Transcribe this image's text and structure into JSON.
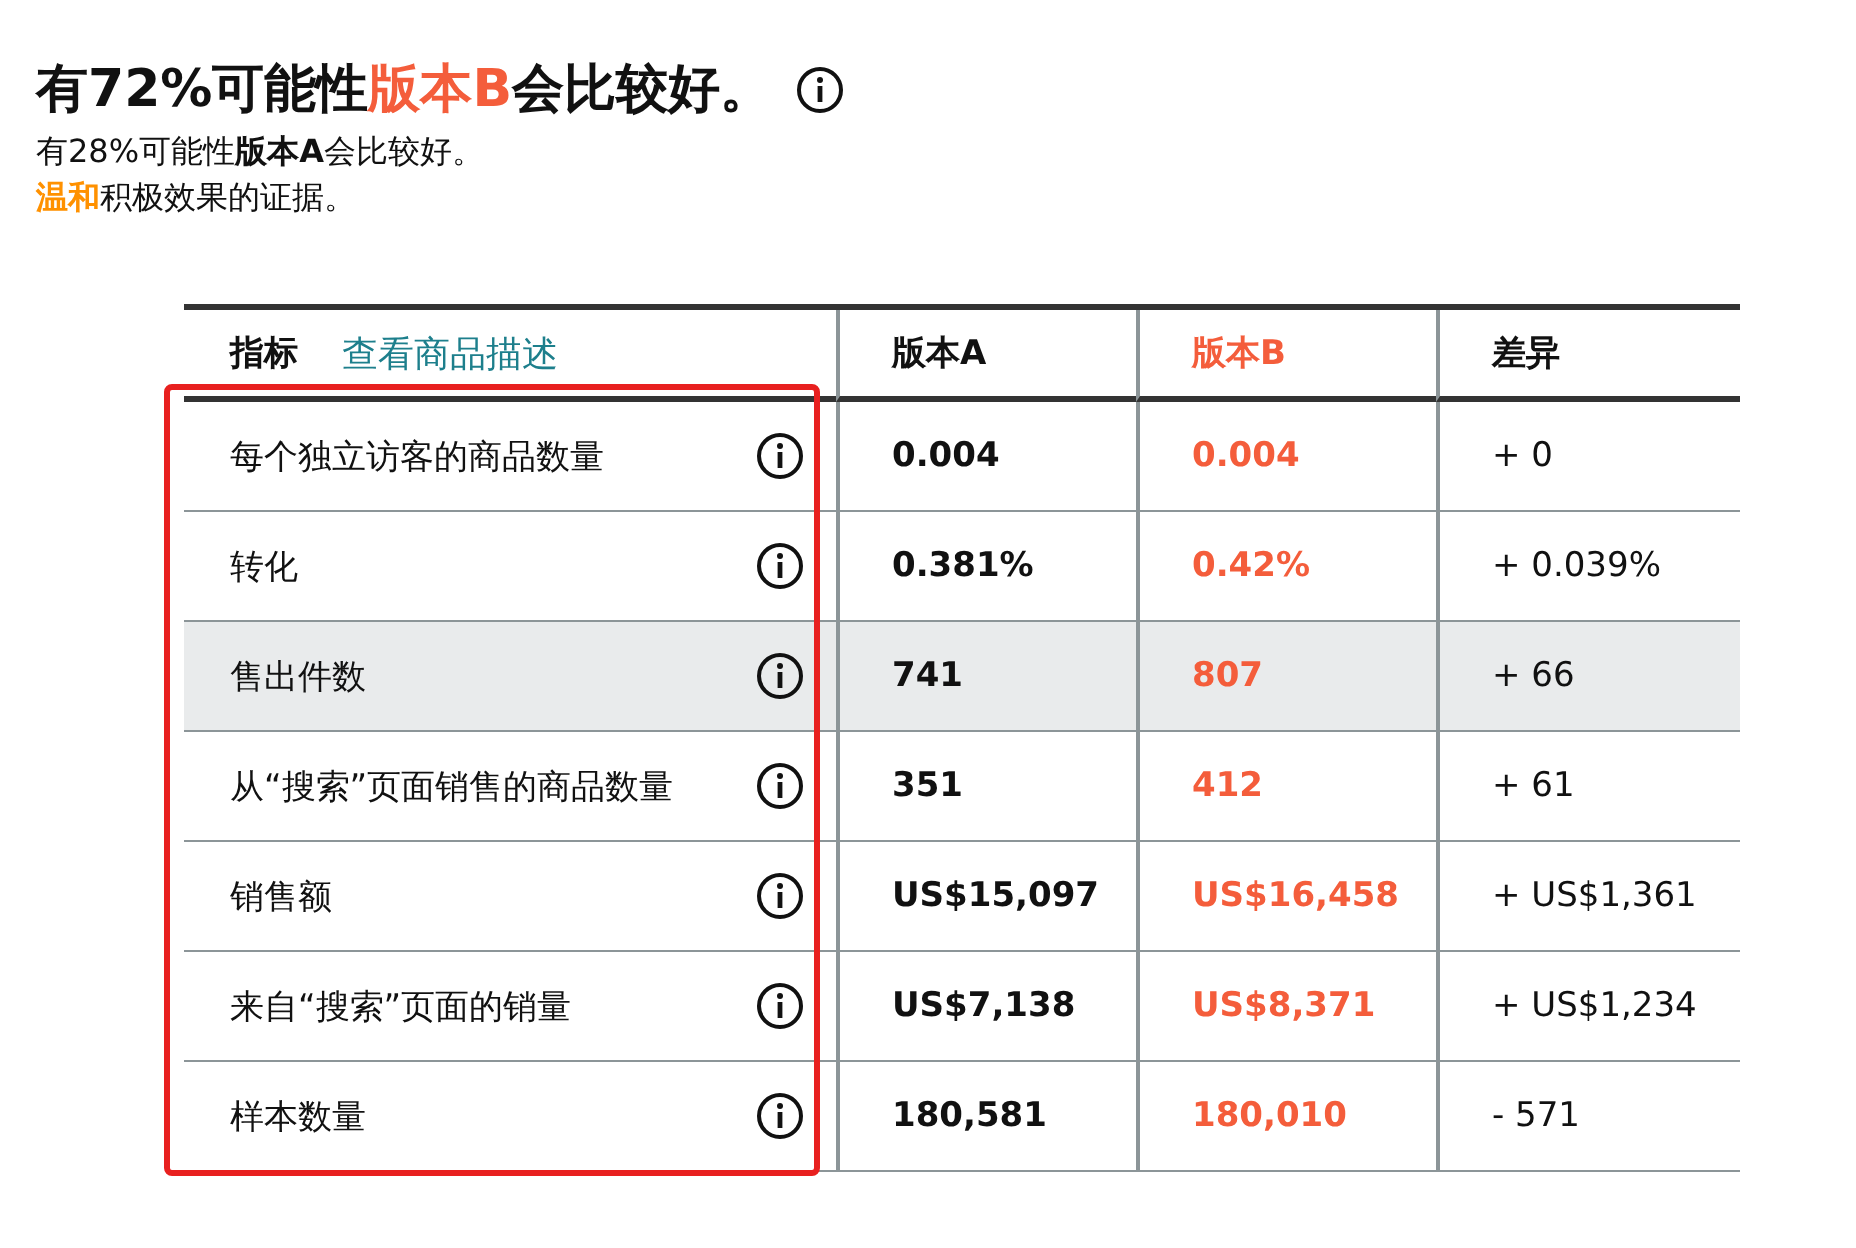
{
  "headline": {
    "segments": [
      {
        "text": "有72%可能性",
        "accent": false
      },
      {
        "text": "版本B",
        "accent": true
      },
      {
        "text": "会比较好。",
        "accent": false
      }
    ]
  },
  "summary": "有28%可能性**版本A**会比较好。",
  "evidence": {
    "segments": [
      {
        "text": "温和",
        "accent": true
      },
      {
        "text": "积极效果的证据。",
        "accent": false
      }
    ]
  },
  "table": {
    "columns": [
      {
        "label": "指标",
        "kind": "metric"
      },
      {
        "label": "版本A",
        "kind": "a"
      },
      {
        "label": "版本B",
        "kind": "b"
      },
      {
        "label": "差异",
        "kind": "diff"
      }
    ],
    "link": "查看商品描述",
    "rows": [
      {
        "metric": "每个独立访客的商品数量",
        "a": "0.004",
        "b": "0.004",
        "diff": "+ 0",
        "highlighted": false
      },
      {
        "metric": "转化",
        "a": "0.381%",
        "b": "0.42%",
        "diff": "+ 0.039%",
        "highlighted": false
      },
      {
        "metric": "售出件数",
        "a": "741",
        "b": "807",
        "diff": "+ 66",
        "highlighted": true
      },
      {
        "metric": "从“搜索”页面销售的商品数量",
        "a": "351",
        "b": "412",
        "diff": "+ 61",
        "highlighted": false
      },
      {
        "metric": "销售额",
        "a": "US$15,097",
        "b": "US$16,458",
        "diff": "+ US$1,361",
        "highlighted": false
      },
      {
        "metric": "来自“搜索”页面的销量",
        "a": "US$7,138",
        "b": "US$8,371",
        "diff": "+ US$1,234",
        "highlighted": false
      },
      {
        "metric": "样本数量",
        "a": "180,581",
        "b": "180,010",
        "diff": "- 571",
        "highlighted": false
      }
    ]
  },
  "annotation": {
    "frame_shown": true
  }
}
